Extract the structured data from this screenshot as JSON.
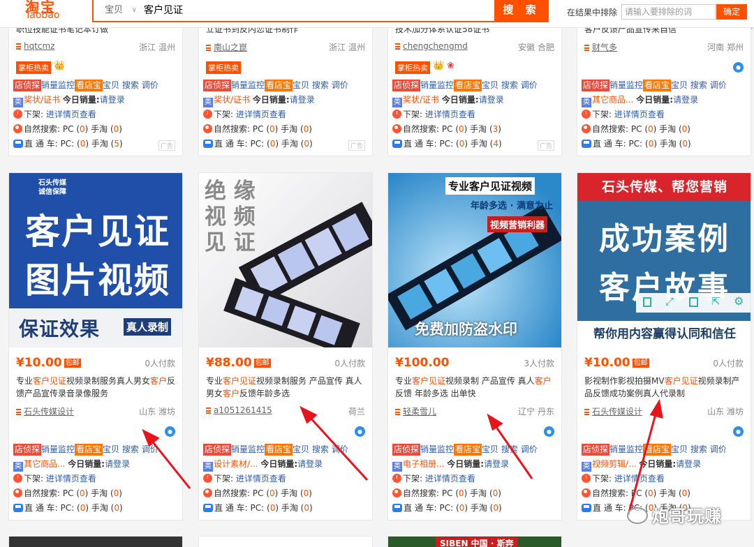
{
  "header": {
    "logo_cn": "淘宝",
    "logo_en": "Taobao",
    "search_category": "宝贝",
    "search_query": "客户见证",
    "search_button": "搜 索",
    "exclude_label": "在结果中排除",
    "exclude_placeholder": "请输入要排除的词",
    "exclude_button": "确定"
  },
  "tool_labels": {
    "tanbao": "店侦探",
    "sales_monitor": "销量监控",
    "kandianbao": "看店宝",
    "baobei": "宝贝",
    "search": "搜索",
    "tiaojia": "调价",
    "cat_icon": "类",
    "today_sales": "今日销量:",
    "please_login": "请登录",
    "offshelf": "下架:",
    "offshelf_detail": "进详情页查看",
    "natural_search": "自然搜索:",
    "pc": "PC",
    "mobile": "手淘",
    "direct": "直 通 车:",
    "hot_badge": "掌柜热卖",
    "ad_badge": "广告",
    "free_ship": "包邮"
  },
  "top_row": [
    {
      "title_partial": "职位技能证书笔记本订做",
      "shop": "hqtcmz",
      "location": "浙江 温州",
      "hot": true,
      "category": "奖状/证书",
      "natural_pc": "0",
      "natural_mobile": "0",
      "direct_pc": "0",
      "direct_mobile": "5"
    },
    {
      "title_partial": "立证书到反内恋证书制作",
      "shop": "南山之崑",
      "location": "浙江 温州",
      "hot": true,
      "category": "奖状/证书",
      "natural_pc": "0",
      "natural_mobile": "0",
      "direct_pc": "0",
      "direct_mobile": "0"
    },
    {
      "title_partial": "技术加分体系认证58证书",
      "shop": "chengchengmd",
      "location": "安徽 合肥",
      "hot": true,
      "category": "奖状/证书",
      "natural_pc": "0",
      "natural_mobile": "3",
      "direct_pc": "0",
      "direct_mobile": "4"
    },
    {
      "title_partial": "客户反馈产品宣传来自信",
      "shop": "财气多",
      "location": "河南 郑州",
      "hot": false,
      "category": "其它商品...",
      "natural_pc": "0",
      "natural_mobile": "0",
      "direct_pc": "0",
      "direct_mobile": "0"
    }
  ],
  "products": [
    {
      "image": {
        "badge_line1": "石头传媒",
        "badge_line2": "诚信保障",
        "line1": "客户见证",
        "line2": "图片视频",
        "bottom_left": "保证效果",
        "bottom_right": "真人录制"
      },
      "price": "¥10.00",
      "paid": "0人付款",
      "title_a": "专业",
      "title_hl1": "客户见证",
      "title_b": "视频录制服务真人男女",
      "title_hl2": "客户",
      "title_c": "反馈产品宣传录音录像服务",
      "shop": "石头传媒设计",
      "location": "山东 潍坊",
      "category": "其它商品...",
      "natural_pc": "0",
      "natural_mobile": "0",
      "direct_pc": "0",
      "direct_mobile": "0"
    },
    {
      "image": {
        "c1": "绝",
        "c2": "缘",
        "c3": "视",
        "c4": "频",
        "c5": "见",
        "c6": "证"
      },
      "price": "¥88.00",
      "paid": "0人付款",
      "title_a": "专业",
      "title_hl1": "客户见证",
      "title_b": "视频录制服务 产品宣传 真人男女",
      "title_hl2": "客户",
      "title_c": "反馈年龄多选",
      "shop": "a1051261415",
      "location": "荷兰",
      "category": "设计素材/...",
      "natural_pc": "0",
      "natural_mobile": "0",
      "direct_pc": "0",
      "direct_mobile": "0"
    },
    {
      "image": {
        "line1": "专业客户见证视频",
        "line2": "年龄多选 · 满意为止",
        "line3": "视频营销利器",
        "bottom": "免费加防盗水印"
      },
      "price": "¥100.00",
      "paid": "3人付款",
      "title_a": "专业",
      "title_hl1": "客户见证",
      "title_b": "视频录制 产品宣传 真人",
      "title_hl2": "客户",
      "title_c": "反馈 年龄多选 出单快",
      "shop": "轻柔雪儿",
      "location": "辽宁 丹东",
      "category": "电子相册...",
      "natural_pc": "0",
      "natural_mobile": "0",
      "direct_pc": "0",
      "direct_mobile": "0"
    },
    {
      "image": {
        "line1": "石头传媒、帮您营销",
        "line2": "成功案例",
        "line3": "客户故事",
        "bottom": "帮你用内容赢得认同和信任"
      },
      "price": "¥10.00",
      "paid": "0人付款",
      "title_a": "影视制作影视拍摄MV",
      "title_hl1": "客户见证",
      "title_b": "视频录制产品反馈成功案例真人代录制",
      "title_hl2": "",
      "title_c": "",
      "shop": "石头传媒设计",
      "location": "山东 潍坊",
      "category": "视频剪辑/...",
      "natural_pc": "0",
      "natural_mobile": "0",
      "direct_pc": "0",
      "direct_mobile": "0"
    }
  ],
  "bottom_peek": {
    "third_text": "SIBEN 中国 · 斯奔"
  },
  "watermark": "炮哥玩赚"
}
